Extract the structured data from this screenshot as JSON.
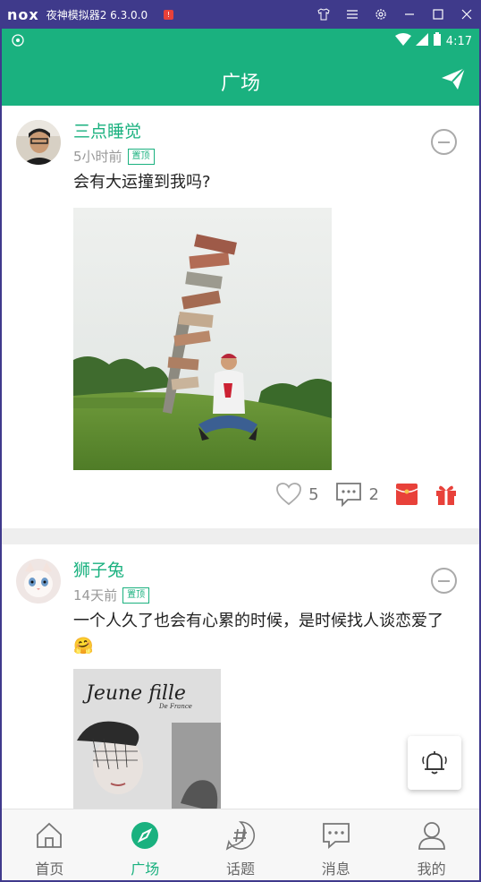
{
  "window": {
    "logo": "nox",
    "title": "夜神模拟器2 6.3.0.0",
    "badge": "!"
  },
  "status_bar": {
    "time": "4:17"
  },
  "app_bar": {
    "title": "广场"
  },
  "posts": [
    {
      "username": "三点睡觉",
      "time": "5小时前",
      "pin_label": "置顶",
      "text": "会有大运撞到我吗?",
      "likes": "5",
      "comments": "2"
    },
    {
      "username": "狮子兔",
      "time": "14天前",
      "pin_label": "置顶",
      "text": "一个人久了也会有心累的时候，是时候找人谈恋爱了",
      "emoji": "🤗",
      "image_caption": "Jeune fille",
      "image_sub": "De France"
    }
  ],
  "bottom_nav": [
    {
      "label": "首页",
      "icon": "home-icon"
    },
    {
      "label": "广场",
      "icon": "compass-icon",
      "active": true
    },
    {
      "label": "话题",
      "icon": "hashtag-icon"
    },
    {
      "label": "消息",
      "icon": "message-icon"
    },
    {
      "label": "我的",
      "icon": "user-icon"
    }
  ],
  "colors": {
    "accent": "#1ab17f",
    "red": "#e8413a",
    "emulator_frame": "#403a8c"
  }
}
